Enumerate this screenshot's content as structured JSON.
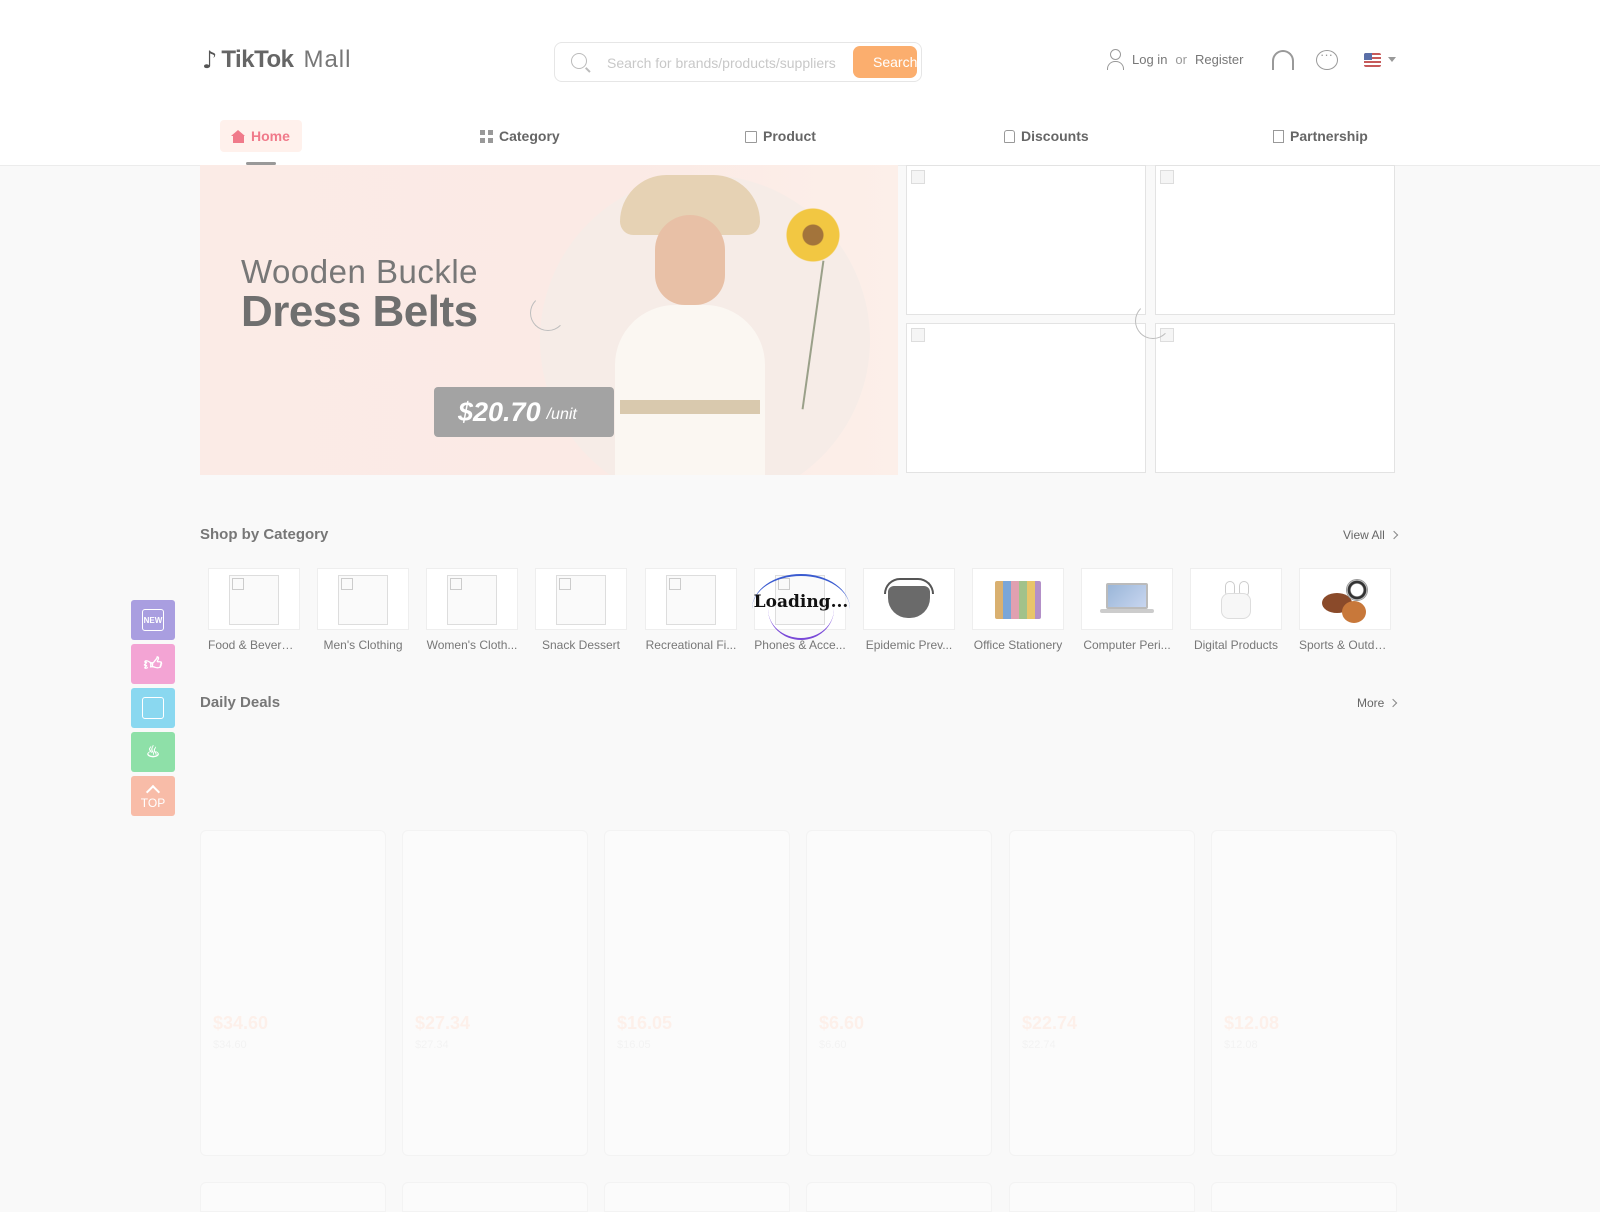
{
  "header": {
    "logo_mark": "♪",
    "logo_text": "TikTok",
    "logo_mall": "Mall",
    "search_placeholder": "Search for brands/products/suppliers",
    "search_button": "Search",
    "login": "Log in",
    "or": "or",
    "register": "Register",
    "icons": [
      "user-icon",
      "headset-icon",
      "chat-icon",
      "us-flag-icon"
    ]
  },
  "nav": {
    "items": [
      {
        "label": "Home",
        "icon": "home-icon",
        "active": true
      },
      {
        "label": "Category",
        "icon": "grid-icon"
      },
      {
        "label": "Product",
        "icon": "bag-icon"
      },
      {
        "label": "Discounts",
        "icon": "tag-icon"
      },
      {
        "label": "Partnership",
        "icon": "building-icon"
      }
    ]
  },
  "banner": {
    "line1": "Wooden Buckle",
    "line2": "Dress Belts",
    "price": "$20.70",
    "unit": "/unit"
  },
  "categories": {
    "title": "Shop by Category",
    "view_all": "View All",
    "items": [
      "Food & Beverage",
      "Men's Clothing",
      "Women's Cloth...",
      "Snack Dessert",
      "Recreational Fi...",
      "Phones & Acce...",
      "Epidemic Prev...",
      "Office Stationery",
      "Computer Peri...",
      "Digital Products",
      "Sports & Outdo..."
    ],
    "loading_text": "Loading..."
  },
  "deals": {
    "title": "Daily Deals",
    "more": "More",
    "items": [
      {
        "price": "$34.60",
        "sub": "$34.60"
      },
      {
        "price": "$27.34",
        "sub": "$27.34"
      },
      {
        "price": "$16.05",
        "sub": "$16.05"
      },
      {
        "price": "$6.60",
        "sub": "$6.60"
      },
      {
        "price": "$22.74",
        "sub": "$22.74"
      },
      {
        "price": "$12.08",
        "sub": "$12.08"
      }
    ]
  },
  "side_tools": {
    "new": "NEW",
    "top": "TOP"
  },
  "colors": {
    "accent": "#f07a8a",
    "search_button": "#fbae6e",
    "side_new": "#a99ee0",
    "side_like": "#f3a4d4",
    "side_store": "#8ad8f0",
    "side_hot": "#8ee0a8",
    "side_top": "#f8bca8"
  }
}
